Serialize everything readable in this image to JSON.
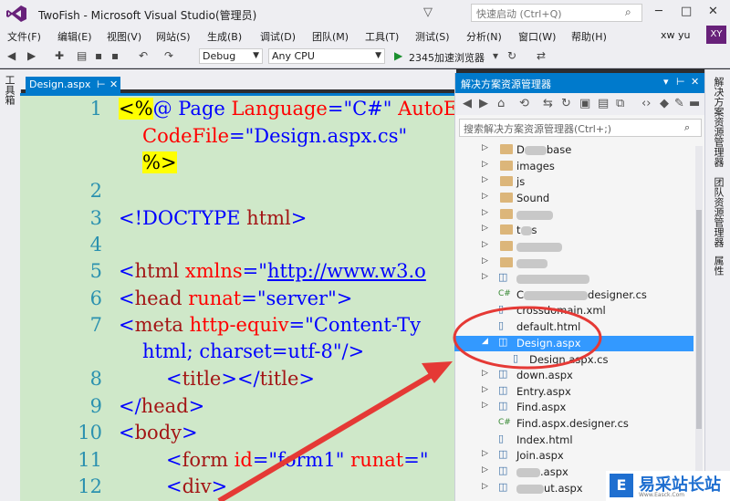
{
  "window": {
    "title": "TwoFish - Microsoft Visual Studio(管理员)",
    "quick_launch_placeholder": "快速启动 (Ctrl+Q)",
    "user_name": "xw yu",
    "user_initials": "XY"
  },
  "menu": [
    "文件(F)",
    "编辑(E)",
    "视图(V)",
    "网站(S)",
    "生成(B)",
    "调试(D)",
    "团队(M)",
    "工具(T)",
    "测试(S)",
    "分析(N)",
    "窗口(W)",
    "帮助(H)"
  ],
  "toolbar": {
    "configuration": "Debug",
    "platform": "Any CPU",
    "browser": "2345加速浏览器"
  },
  "left_strip": {
    "toolbox_label": "工具箱"
  },
  "editor": {
    "tab_title": "Design.aspx",
    "line_numbers": [
      "1",
      "2",
      "3",
      "4",
      "5",
      "6",
      "7",
      "8",
      "9",
      "10",
      "11",
      "12"
    ],
    "lines": {
      "l1a": "<%",
      "l1b": "@ Page ",
      "l1c": "Language",
      "l1d": "=\"C#\" ",
      "l1e": "AutoE",
      "l1_cont_a": "CodeFile",
      "l1_cont_b": "=\"Design.aspx.cs\"",
      "l1_cont_c": "%>",
      "l3a": "<!DOCTYPE ",
      "l3b": "html",
      "l3c": ">",
      "l5a": "<",
      "l5b": "html ",
      "l5c": "xmlns",
      "l5d": "=\"",
      "l5e": "http://www.w3.o",
      "l6a": "<",
      "l6b": "head ",
      "l6c": "runat",
      "l6d": "=\"server\">",
      "l7a": "<",
      "l7b": "meta ",
      "l7c": "http-equiv",
      "l7d": "=\"Content-Ty",
      "l7_cont": "html; charset=utf-8\"/>",
      "l8a": "<",
      "l8b": "title",
      "l8c": "></",
      "l8d": "title",
      "l8e": ">",
      "l9a": "</",
      "l9b": "head",
      "l9c": ">",
      "l10a": "<",
      "l10b": "body",
      "l10c": ">",
      "l11a": "<",
      "l11b": "form ",
      "l11c": "id",
      "l11d": "=\"form1\" ",
      "l11e": "runat",
      "l11f": "=\"",
      "l12a": "<",
      "l12b": "div",
      "l12c": ">"
    }
  },
  "solution_explorer": {
    "title": "解决方案资源管理器",
    "search_placeholder": "搜索解决方案资源管理器(Ctrl+;)",
    "items": [
      {
        "label_pre": "D",
        "label_post": "base",
        "kind": "folder",
        "blurred": true
      },
      {
        "label": "images",
        "kind": "folder"
      },
      {
        "label": "js",
        "kind": "folder"
      },
      {
        "label": "Sound",
        "kind": "folder"
      },
      {
        "label": "",
        "kind": "folder",
        "blurred": true
      },
      {
        "label_pre": "t",
        "label_post": "s",
        "kind": "folder",
        "blurred": true
      },
      {
        "label": "",
        "kind": "folder",
        "blurred": true
      },
      {
        "label": "",
        "kind": "folder",
        "blurred": true
      },
      {
        "label": "",
        "kind": "aspx",
        "blurred": true
      },
      {
        "label_pre": "C",
        "label_post": "designer.cs",
        "kind": "cs",
        "blurred": true
      },
      {
        "label": "crossdomain.xml",
        "kind": "file"
      },
      {
        "label": "default.html",
        "kind": "file"
      },
      {
        "label": "Design.aspx",
        "kind": "aspx",
        "selected": true
      },
      {
        "label": "Design.aspx.cs",
        "kind": "cs-child"
      },
      {
        "label": "down.aspx",
        "kind": "aspx"
      },
      {
        "label": "Entry.aspx",
        "kind": "aspx"
      },
      {
        "label": "Find.aspx",
        "kind": "aspx"
      },
      {
        "label": "Find.aspx.designer.cs",
        "kind": "cs"
      },
      {
        "label": "Index.html",
        "kind": "file"
      },
      {
        "label": "Join.aspx",
        "kind": "aspx"
      },
      {
        "label_pre": "",
        "label_post": ".aspx",
        "kind": "aspx",
        "blurred": true
      },
      {
        "label_pre": "",
        "label_post": "ut.aspx",
        "kind": "aspx",
        "blurred": true
      }
    ]
  },
  "right_strip": [
    "解决方案资源管理器",
    "团队资源管理器",
    "属性"
  ],
  "watermark": {
    "text": "易采站长站",
    "logo_letter": "E",
    "sub": "Www.Easck.Com"
  },
  "colors": {
    "accent": "#007acc",
    "selection": "#3399ff",
    "editor_bg": "#cfe8c9",
    "annotation": "#e53935"
  }
}
